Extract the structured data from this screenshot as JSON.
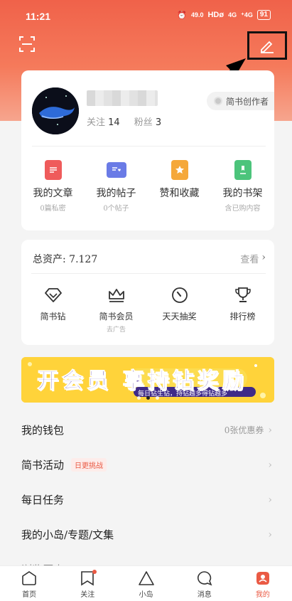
{
  "status_bar": {
    "time": "11:21",
    "speed": "49.0",
    "speed_unit": "KB/S",
    "hd": "HDø",
    "net1": "4G",
    "net2": "⁺4G",
    "battery": "91"
  },
  "profile": {
    "follow_label": "关注",
    "follow_count": "14",
    "fans_label": "粉丝",
    "fans_count": "3",
    "creator_badge": "简书创作者"
  },
  "quick_links": [
    {
      "title": "我的文章",
      "sub": "0篇私密",
      "color": "#ef5b5b",
      "icon": "article-icon"
    },
    {
      "title": "我的帖子",
      "sub": "0个帖子",
      "color": "#6a7be6",
      "icon": "post-icon"
    },
    {
      "title": "赞和收藏",
      "sub": "",
      "color": "#f5a83a",
      "icon": "star-icon"
    },
    {
      "title": "我的书架",
      "sub": "含已购内容",
      "color": "#4cc47b",
      "icon": "bookshelf-icon"
    }
  ],
  "assets": {
    "title": "总资产: 7.127",
    "more": "查看",
    "items": [
      {
        "label": "简书钻",
        "sub": "",
        "icon": "diamond-icon"
      },
      {
        "label": "简书会员",
        "sub": "去广告",
        "icon": "crown-icon"
      },
      {
        "label": "天天抽奖",
        "sub": "",
        "icon": "dial-icon"
      },
      {
        "label": "排行榜",
        "sub": "",
        "icon": "trophy-icon"
      }
    ]
  },
  "banner": {
    "main": "开会员 享持钻奖励",
    "sub": "每日钻生钻，持钻越多得钻越多"
  },
  "menu": [
    {
      "label": "我的钱包",
      "right": "0张优惠券",
      "tag": ""
    },
    {
      "label": "简书活动",
      "right": "",
      "tag": "日更挑战"
    },
    {
      "label": "每日任务",
      "right": "",
      "tag": ""
    },
    {
      "label": "我的小岛/专题/文集",
      "right": "",
      "tag": ""
    },
    {
      "label": "浏览历史",
      "right": "",
      "tag": ""
    }
  ],
  "tabs": [
    {
      "label": "首页",
      "icon": "home-icon"
    },
    {
      "label": "关注",
      "icon": "follow-icon"
    },
    {
      "label": "小岛",
      "icon": "island-icon"
    },
    {
      "label": "消息",
      "icon": "message-icon"
    },
    {
      "label": "我的",
      "icon": "profile-icon"
    }
  ],
  "colors": {
    "accent": "#ea5a44",
    "hero_top": "#f0624a"
  }
}
